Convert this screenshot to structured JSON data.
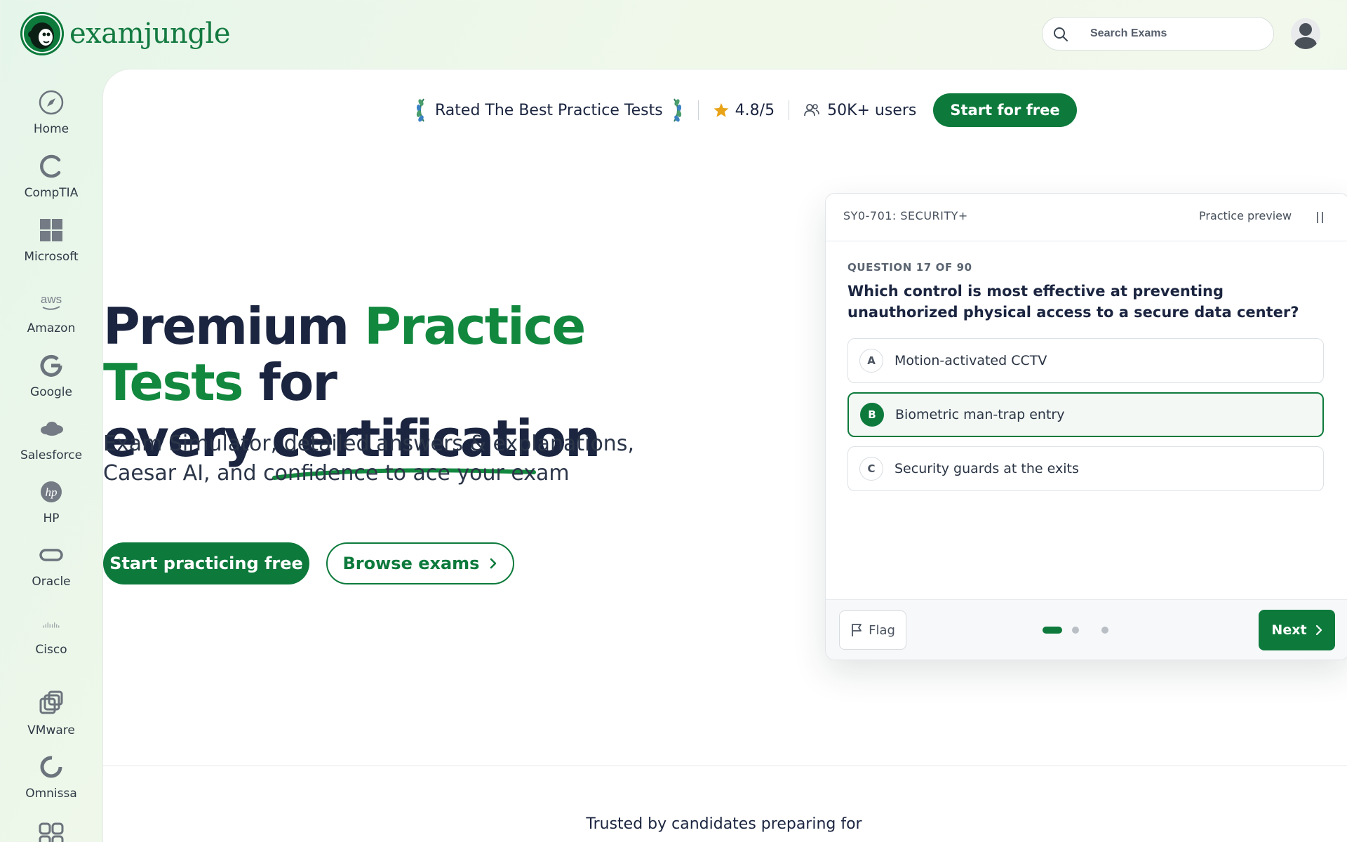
{
  "brand": {
    "name": "examjungle"
  },
  "search": {
    "placeholder": "Search Exams"
  },
  "sidebar": {
    "items": [
      {
        "label": "Home",
        "icon": "compass-icon"
      },
      {
        "label": "CompTIA",
        "icon": "comptia-logo-icon"
      },
      {
        "label": "Microsoft",
        "icon": "microsoft-logo-icon"
      },
      {
        "label": "Amazon",
        "icon": "aws-logo-icon"
      },
      {
        "label": "Google",
        "icon": "google-logo-icon"
      },
      {
        "label": "Salesforce",
        "icon": "salesforce-cloud-icon"
      },
      {
        "label": "HP",
        "icon": "hp-logo-icon"
      },
      {
        "label": "Oracle",
        "icon": "oracle-logo-icon"
      },
      {
        "label": "Cisco",
        "icon": "cisco-logo-icon"
      },
      {
        "label": "VMware",
        "icon": "vmware-logo-icon"
      },
      {
        "label": "Omnissa",
        "icon": "omnissa-logo-icon"
      },
      {
        "label": "",
        "icon": "grid-icon"
      }
    ]
  },
  "rating": {
    "headline": "Rated The Best Practice Tests",
    "score": "4.8/5",
    "users": "50K+ users",
    "cta": "Start for free",
    "star_color": "#e8a317"
  },
  "hero": {
    "title_part1": "Premium",
    "title_green": "Practice Tests",
    "title_part2": "for",
    "title_part3": "every",
    "title_part4": "certification",
    "subtitle": "Exam Simulator, detailed answers & explanations, Caesar AI, and confidence to ace your exam",
    "primary_cta": "Start practicing free",
    "secondary_cta": "Browse exams"
  },
  "quiz": {
    "exam_code": "SY0-701: SECURITY+",
    "mode": "Practice preview",
    "question_number": "QUESTION 17 OF 90",
    "question": "Which control is most effective at preventing unauthorized physical access to a secure data center?",
    "options": [
      {
        "letter": "A",
        "text": "Motion-activated CCTV",
        "selected": false
      },
      {
        "letter": "B",
        "text": "Biometric man-trap entry",
        "selected": true
      },
      {
        "letter": "C",
        "text": "Security guards at the exits",
        "selected": false
      }
    ],
    "flag_label": "Flag",
    "next_label": "Next",
    "progress": {
      "current": 1,
      "total": 3
    }
  },
  "trusted": {
    "text": "Trusted by candidates preparing for"
  },
  "colors": {
    "brand_green": "#0d7a3c",
    "hero_green": "#12883f",
    "ink": "#1b2540"
  }
}
